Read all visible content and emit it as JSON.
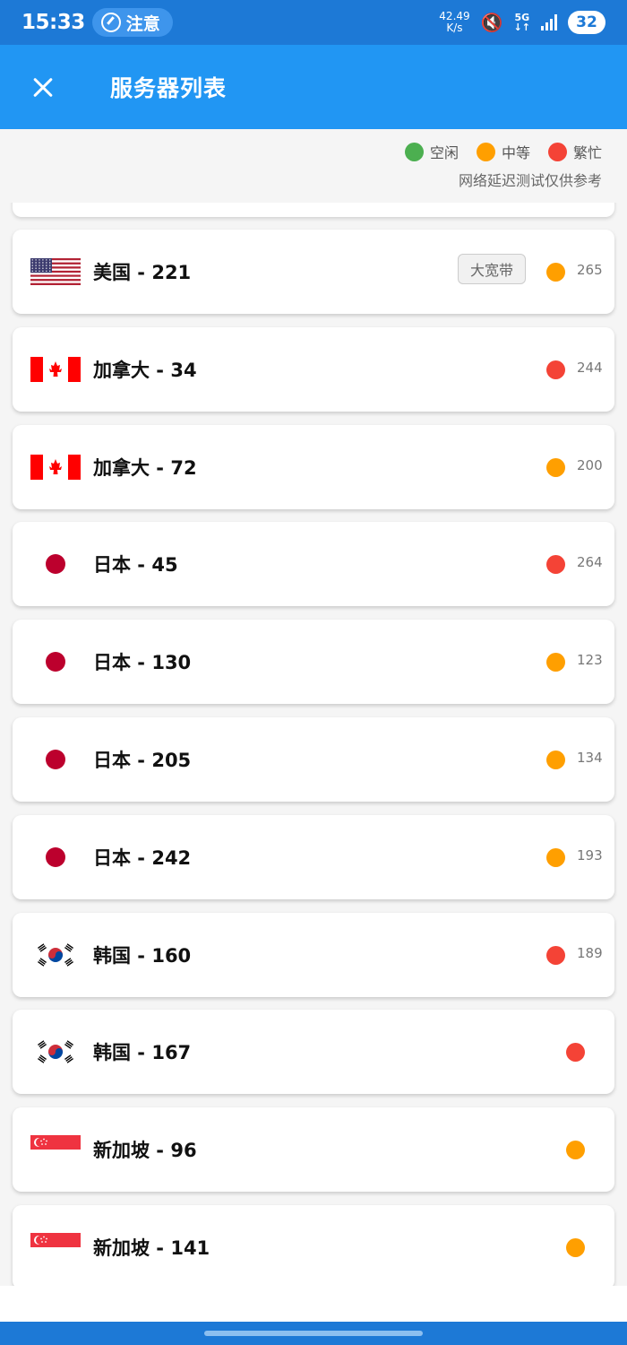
{
  "status_bar": {
    "time": "15:33",
    "notice": "注意",
    "net_speed_value": "42.49",
    "net_speed_unit": "K/s",
    "network": "5G",
    "battery": "32"
  },
  "app_bar": {
    "title": "服务器列表",
    "close_icon": "close-icon"
  },
  "legend": {
    "items": [
      {
        "label": "空闲",
        "color": "#4caf50"
      },
      {
        "label": "中等",
        "color": "#ff9f00"
      },
      {
        "label": "繁忙",
        "color": "#f44336"
      }
    ],
    "note": "网络延迟测试仅供参考"
  },
  "status_colors": {
    "idle": "#4caf50",
    "medium": "#ff9f00",
    "busy": "#f44336"
  },
  "servers": [
    {
      "country": "us",
      "name": "美国 - 221",
      "tag": "大宽带",
      "status": "medium",
      "latency": "265"
    },
    {
      "country": "ca",
      "name": "加拿大 - 34",
      "tag": "",
      "status": "busy",
      "latency": "244"
    },
    {
      "country": "ca",
      "name": "加拿大 - 72",
      "tag": "",
      "status": "medium",
      "latency": "200"
    },
    {
      "country": "jp",
      "name": "日本 - 45",
      "tag": "",
      "status": "busy",
      "latency": "264"
    },
    {
      "country": "jp",
      "name": "日本 - 130",
      "tag": "",
      "status": "medium",
      "latency": "123"
    },
    {
      "country": "jp",
      "name": "日本 - 205",
      "tag": "",
      "status": "medium",
      "latency": "134"
    },
    {
      "country": "jp",
      "name": "日本 - 242",
      "tag": "",
      "status": "medium",
      "latency": "193"
    },
    {
      "country": "kr",
      "name": "韩国 - 160",
      "tag": "",
      "status": "busy",
      "latency": "189"
    },
    {
      "country": "kr",
      "name": "韩国 - 167",
      "tag": "",
      "status": "busy",
      "latency": ""
    },
    {
      "country": "sg",
      "name": "新加坡 - 96",
      "tag": "",
      "status": "medium",
      "latency": ""
    },
    {
      "country": "sg",
      "name": "新加坡 - 141",
      "tag": "",
      "status": "medium",
      "latency": ""
    }
  ]
}
